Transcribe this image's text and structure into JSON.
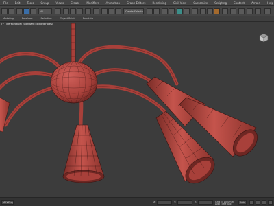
{
  "menu": {
    "items": [
      "File",
      "Edit",
      "Tools",
      "Group",
      "Views",
      "Create",
      "Modifiers",
      "Animation",
      "Graph Editors",
      "Rendering",
      "Civil View",
      "Customize",
      "Scripting",
      "Content",
      "Arnold",
      "Help"
    ]
  },
  "toolbar": {
    "selection_filter": "All",
    "named_selection": "Create Selection Se"
  },
  "ribbon": {
    "tabs": [
      "Modeling",
      "Freeform",
      "Selection",
      "Object Paint",
      "Populate"
    ]
  },
  "viewport": {
    "label": "[+] [Perspective] [Standard] [Edged Faces]",
    "viewcube_label": "FRONT"
  },
  "statusbar": {
    "script_label": "MAXScript Mi",
    "x_label": "X:",
    "x_value": "",
    "y_label": "Y:",
    "y_value": "",
    "z_label": "Z:",
    "z_value": "",
    "grid": "Grid = 10,0mm",
    "add_time_tag": "Add Time Tag",
    "auto_key": "Auto"
  },
  "colors": {
    "mesh_fill": "#b0443e",
    "mesh_fill_light": "#c9574e",
    "mesh_fill_dark": "#6e2723",
    "wire": "#3a1412",
    "viewport_bg": "#3c3c3c"
  }
}
